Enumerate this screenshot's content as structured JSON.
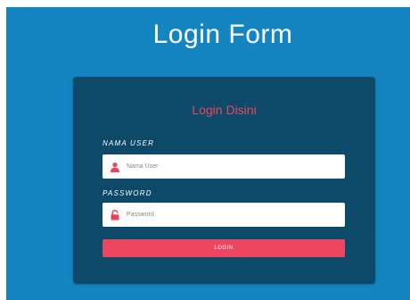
{
  "page": {
    "title": "Login Form"
  },
  "card": {
    "title": "Login Disini"
  },
  "username": {
    "label": "NAMA USER",
    "placeholder": "Nama User",
    "value": "",
    "icon": "user-icon"
  },
  "password": {
    "label": "PASSWORD",
    "placeholder": "Password",
    "value": "",
    "icon": "lock-icon"
  },
  "login": {
    "label": "LOGIN"
  },
  "colors": {
    "background": "#1585c2",
    "card": "#0d4a6a",
    "accent": "#e8475a",
    "button": "#ee4560"
  }
}
